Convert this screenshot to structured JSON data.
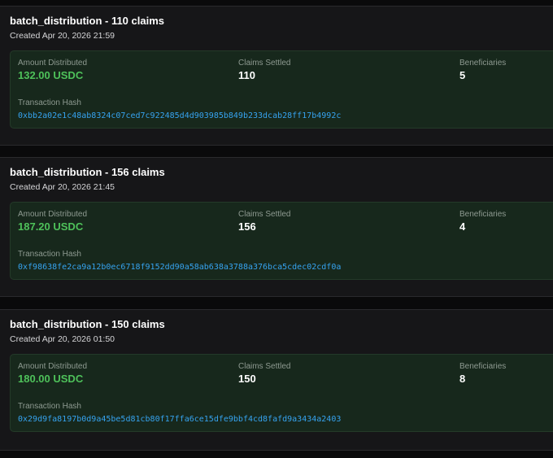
{
  "batches": [
    {
      "title": "batch_distribution - 110 claims",
      "created": "Created Apr 20, 2026 21:59",
      "amount_label": "Amount Distributed",
      "amount_value": "132.00 USDC",
      "claims_label": "Claims Settled",
      "claims_value": "110",
      "beneficiaries_label": "Beneficiaries",
      "beneficiaries_value": "5",
      "hash_label": "Transaction Hash",
      "hash_value": "0xbb2a02e1c48ab8324c07ced7c922485d4d903985b849b233dcab28ff17b4992c"
    },
    {
      "title": "batch_distribution - 156 claims",
      "created": "Created Apr 20, 2026 21:45",
      "amount_label": "Amount Distributed",
      "amount_value": "187.20 USDC",
      "claims_label": "Claims Settled",
      "claims_value": "156",
      "beneficiaries_label": "Beneficiaries",
      "beneficiaries_value": "4",
      "hash_label": "Transaction Hash",
      "hash_value": "0xf98638fe2ca9a12b0ec6718f9152dd90a58ab638a3788a376bca5cdec02cdf0a"
    },
    {
      "title": "batch_distribution - 150 claims",
      "created": "Created Apr 20, 2026 01:50",
      "amount_label": "Amount Distributed",
      "amount_value": "180.00 USDC",
      "claims_label": "Claims Settled",
      "claims_value": "150",
      "beneficiaries_label": "Beneficiaries",
      "beneficiaries_value": "8",
      "hash_label": "Transaction Hash",
      "hash_value": "0x29d9fa8197b0d9a45be5d81cb80f17ffa6ce15dfe9bbf4cd8fafd9a3434a2403"
    }
  ],
  "colors": {
    "background": "#0a0a0b",
    "card": "#161618",
    "panel": "#17281c",
    "amount": "#4ec15a",
    "hash_link": "#36a3f0"
  }
}
